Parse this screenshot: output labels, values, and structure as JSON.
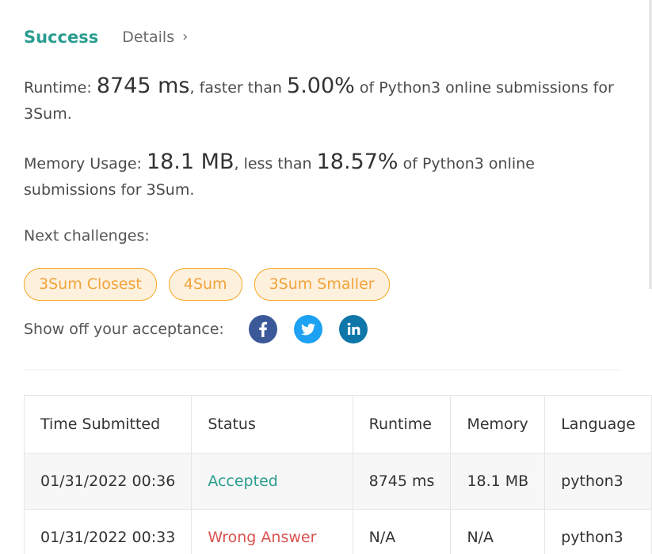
{
  "header": {
    "status": "Success",
    "details_label": "Details",
    "details_chevron": "›"
  },
  "runtime": {
    "label": "Runtime: ",
    "value": "8745 ms",
    "mid": ", faster than ",
    "percent": "5.00%",
    "tail": " of Python3 online submissions for 3Sum."
  },
  "memory": {
    "label": "Memory Usage: ",
    "value": "18.1 MB",
    "mid": ", less than ",
    "percent": "18.57%",
    "tail": " of Python3 online submissions for 3Sum."
  },
  "next": {
    "label": "Next challenges:",
    "challenges": [
      "3Sum Closest",
      "4Sum",
      "3Sum Smaller"
    ]
  },
  "share": {
    "label": "Show off your acceptance:",
    "icons": [
      "facebook-icon",
      "twitter-icon",
      "linkedin-icon"
    ]
  },
  "table": {
    "headers": [
      "Time Submitted",
      "Status",
      "Runtime",
      "Memory",
      "Language"
    ],
    "rows": [
      {
        "time": "01/31/2022 00:36",
        "status": "Accepted",
        "runtime": "8745 ms",
        "memory": "18.1 MB",
        "language": "python3"
      },
      {
        "time": "01/31/2022 00:33",
        "status": "Wrong Answer",
        "runtime": "N/A",
        "memory": "N/A",
        "language": "python3"
      }
    ]
  },
  "colors": {
    "success": "#2a9d8f",
    "wrong": "#d9534f",
    "chip_border": "#f5a623",
    "chip_bg": "#fdf1de",
    "facebook": "#3b5998",
    "twitter": "#1da1f2",
    "linkedin": "#0e76a8"
  }
}
